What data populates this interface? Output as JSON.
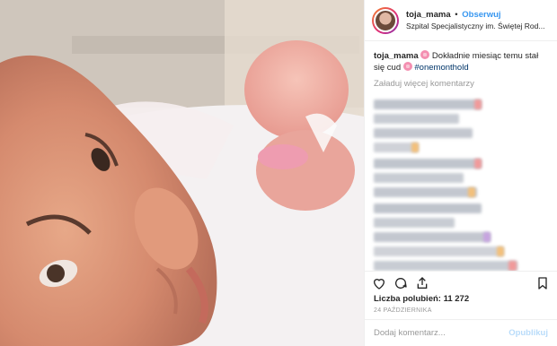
{
  "header": {
    "username": "toja_mama",
    "separator": "•",
    "follow_label": "Obserwuj",
    "location": "Szpital Specjalistyczny im. Świętej Rod..."
  },
  "caption": {
    "username": "toja_mama",
    "text_part1": "Dokładnie miesiąc temu stał się cud",
    "hashtag": "#onemonthold"
  },
  "load_more": "Załaduj więcej komentarzy",
  "likes": "Liczba polubień: 11 272",
  "date": "24 PAŹDZIERNIKA",
  "add_comment": {
    "placeholder": "Dodaj komentarz...",
    "post_label": "Opublikuj"
  },
  "icons": {
    "like": "heart-icon",
    "comment": "comment-icon",
    "share": "share-icon",
    "save": "bookmark-icon"
  },
  "colors": {
    "follow": "#3897f0",
    "hashtag": "#003569",
    "muted": "#999999",
    "text": "#262626"
  }
}
